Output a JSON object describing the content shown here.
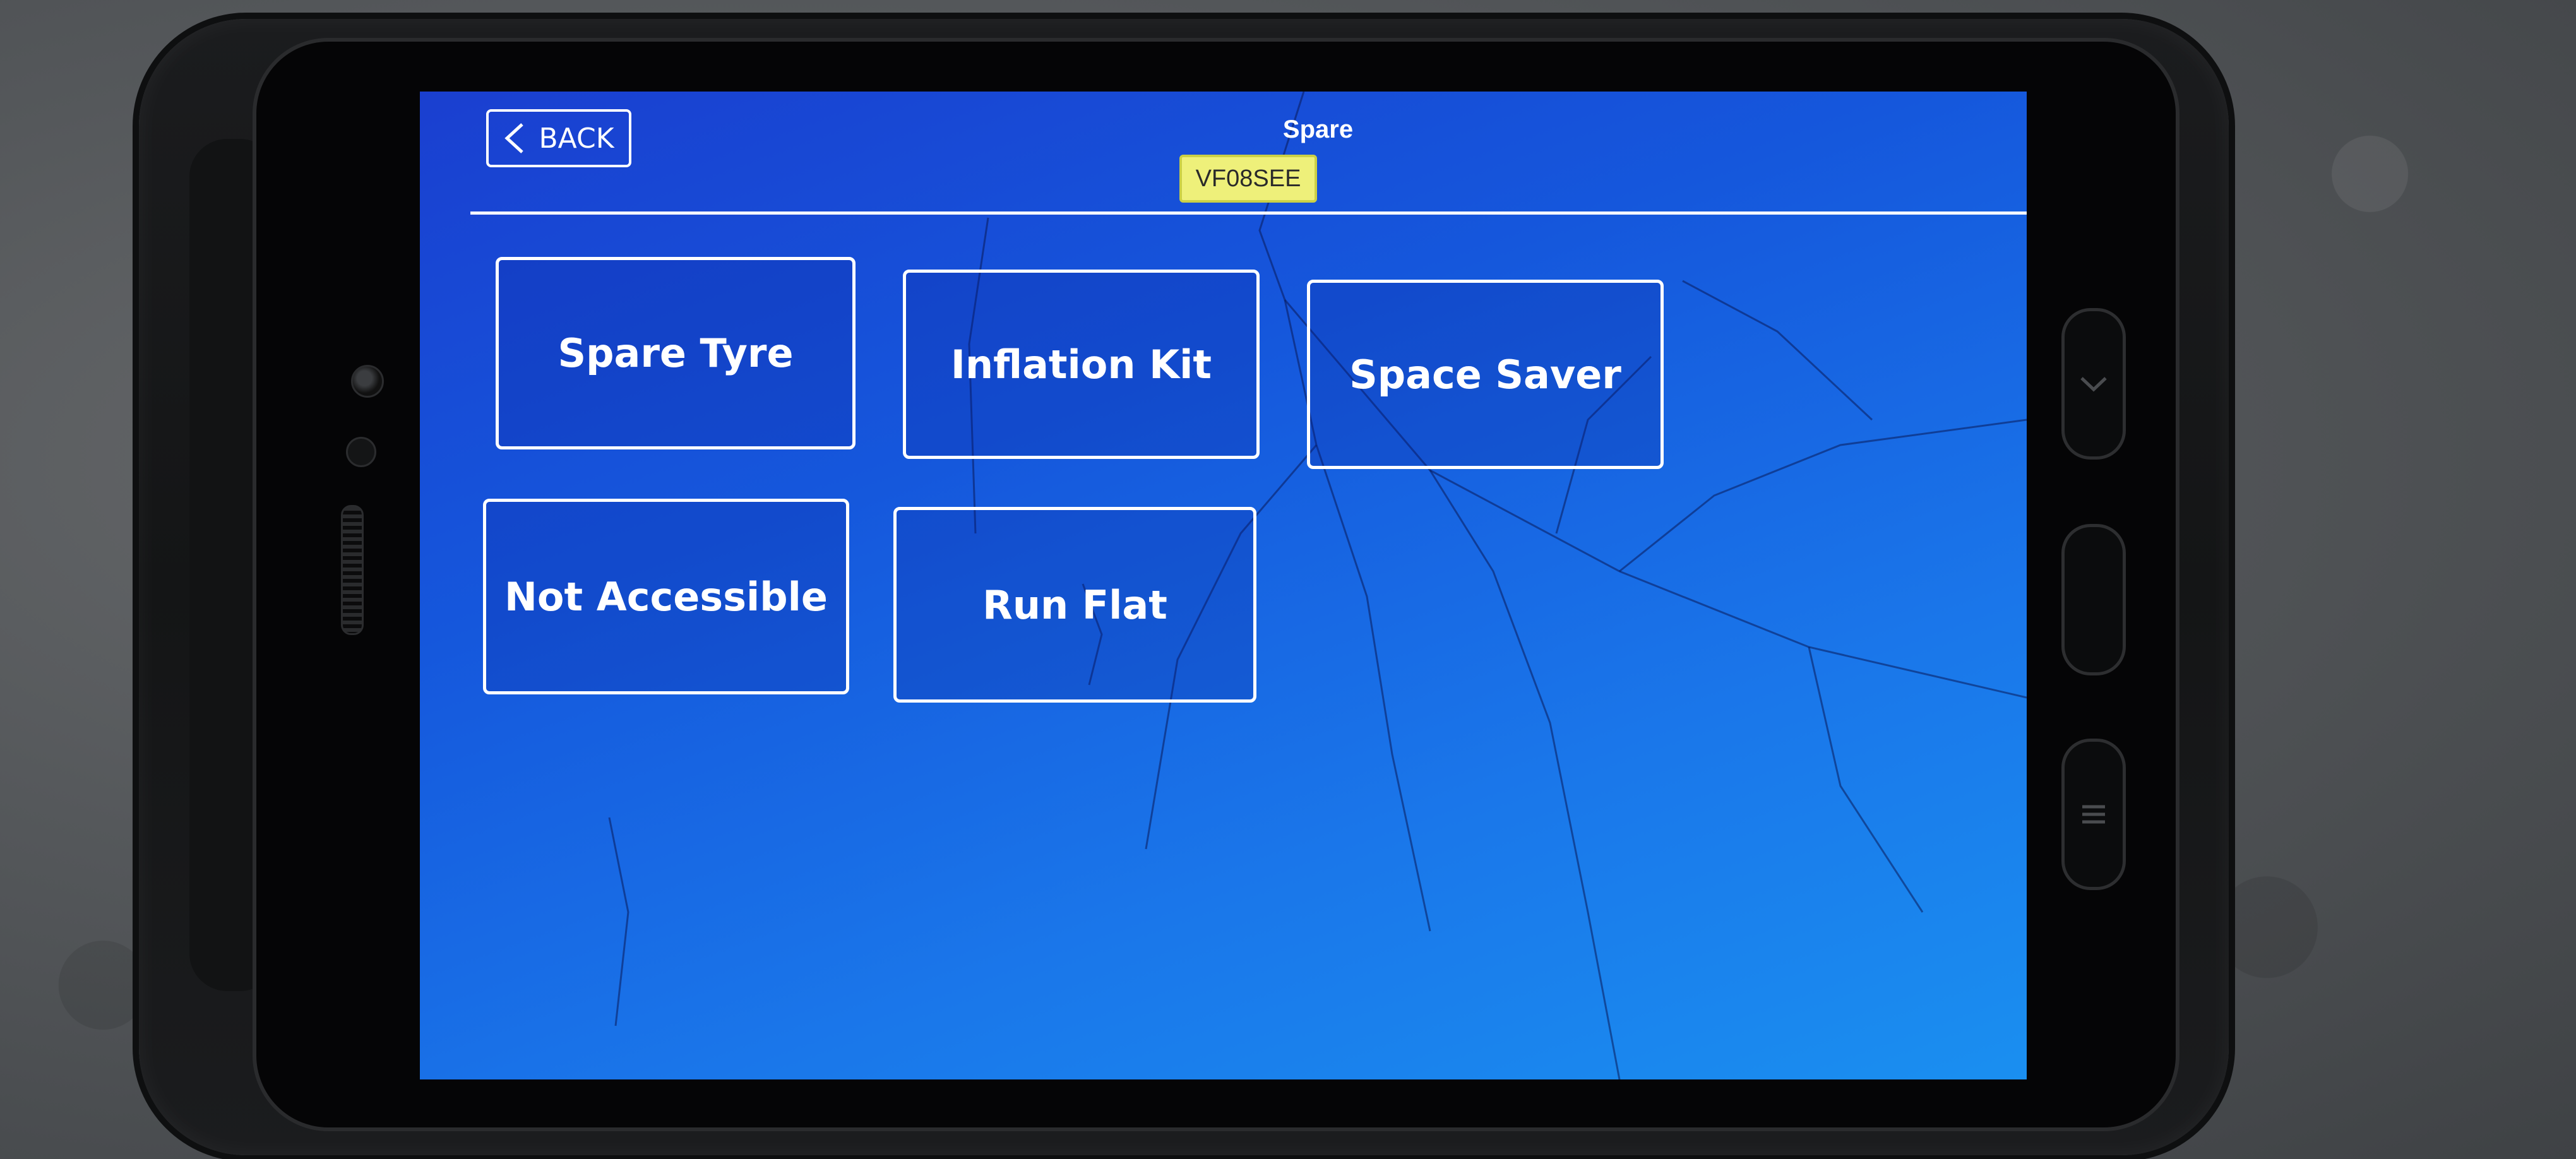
{
  "header": {
    "back_label": "BACK",
    "title": "Spare",
    "registration": "VF08SEE"
  },
  "options": [
    {
      "label": "Spare Tyre"
    },
    {
      "label": "Inflation Kit"
    },
    {
      "label": "Space Saver"
    },
    {
      "label": "Not Accessible"
    },
    {
      "label": "Run Flat"
    }
  ],
  "colors": {
    "screen_background_top": "#1a3fd0",
    "screen_background_bottom": "#1a8ff0",
    "button_border": "#ffffff",
    "registration_badge": "#eef07a",
    "text": "#ffffff"
  },
  "icons": {
    "back": "chevron-left-icon",
    "hw_back": "chevron-down-icon",
    "hw_home": "home-key",
    "hw_menu": "menu-lines-icon"
  }
}
